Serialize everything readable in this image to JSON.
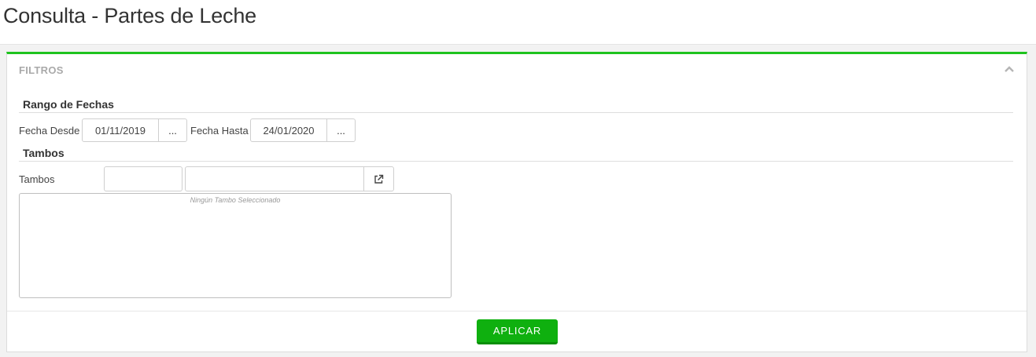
{
  "page": {
    "title": "Consulta - Partes de Leche"
  },
  "filters": {
    "title": "FILTROS",
    "collapse_icon": "chevron-up-icon",
    "accent_color": "#1ec31e",
    "date_range": {
      "section_title": "Rango de Fechas",
      "from_label": "Fecha Desde",
      "from_value": "01/11/2019",
      "from_button": "...",
      "to_label": "Fecha Hasta",
      "to_value": "24/01/2020",
      "to_button": "..."
    },
    "tambos": {
      "section_title": "Tambos",
      "label": "Tambos",
      "code_value": "",
      "name_value": "",
      "open_icon": "external-link-icon",
      "empty_message": "Ningún Tambo Seleccionado"
    },
    "apply_button": "APLICAR",
    "apply_color": "#0fb00f"
  }
}
